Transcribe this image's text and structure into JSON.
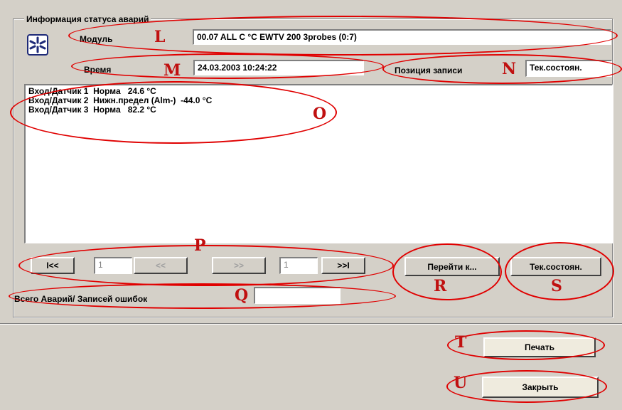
{
  "group_title": "Информация статуса аварий",
  "module": {
    "label": "Модуль",
    "value": "00.07 ALL C °C    EWTV 200 3probes (0:7)"
  },
  "time": {
    "label": "Время",
    "value": "24.03.2003 10:24:22"
  },
  "record_position": {
    "label": "Позиция записи",
    "value": "Тек.состоян."
  },
  "log_lines": [
    "Вход/Датчик 1  Норма   24.6 °C",
    "Вход/Датчик 2  Нижн.предел (Alm-)  -44.0 °C",
    "Вход/Датчик 3  Норма   82.2 °C"
  ],
  "nav": {
    "first": "I<<",
    "left_index": "1",
    "prev": "<<",
    "next": ">>",
    "right_index": "1",
    "last": ">>I"
  },
  "goto_button": "Перейти к...",
  "current_state_button": "Тек.состоян.",
  "total_label": "Всего Аварий/ Записей ошибок",
  "total_value": "",
  "print_button": "Печать",
  "close_button": "Закрыть",
  "markers": {
    "L": "L",
    "M": "M",
    "N": "N",
    "O": "O",
    "P": "P",
    "Q": "Q",
    "R": "R",
    "S": "S",
    "T": "T",
    "U": "U"
  },
  "colors": {
    "window_bg": "#d4d0c8",
    "annotation": "#e00000",
    "marker_text": "#c01010"
  }
}
